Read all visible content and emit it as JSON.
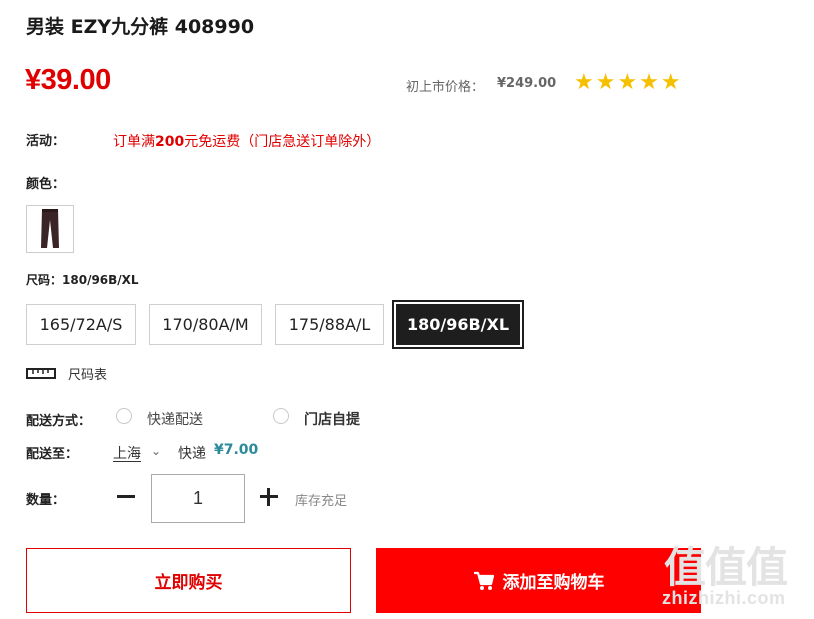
{
  "product": {
    "title": "男装 EZY九分裤 408990",
    "price": "¥39.00",
    "original_price_label": "初上市价格：",
    "original_price": "¥249.00",
    "rating_stars": "★★★★★",
    "rating": 5
  },
  "promotion": {
    "label": "活动：",
    "text_prefix": "订单满",
    "text_bold": "200",
    "text_suffix": "元免运费（门店急送订单除外）"
  },
  "color": {
    "label": "颜色：",
    "swatch_color": "#3a2428"
  },
  "size": {
    "label": "尺码：",
    "selected": "180/96B/XL",
    "options": [
      "165/72A/S",
      "170/80A/M",
      "175/88A/L",
      "180/96B/XL"
    ],
    "chart_link": "尺码表"
  },
  "delivery": {
    "method_label": "配送方式：",
    "options": [
      "快递配送",
      "门店自提"
    ],
    "to_label": "配送至：",
    "city": "上海",
    "express_label": "快递",
    "express_price": "¥7.00"
  },
  "quantity": {
    "label": "数量：",
    "value": "1",
    "stock_text": "库存充足"
  },
  "actions": {
    "buy_now": "立即购买",
    "add_to_cart": "添加至购物车"
  },
  "watermark": {
    "chinese": "值值值",
    "site": "zhizhizhi.com"
  },
  "colors": {
    "accent_red": "#e00000",
    "cart_red": "#ff0000",
    "star_yellow": "#f5c000",
    "express_teal": "#2b8a9a"
  }
}
